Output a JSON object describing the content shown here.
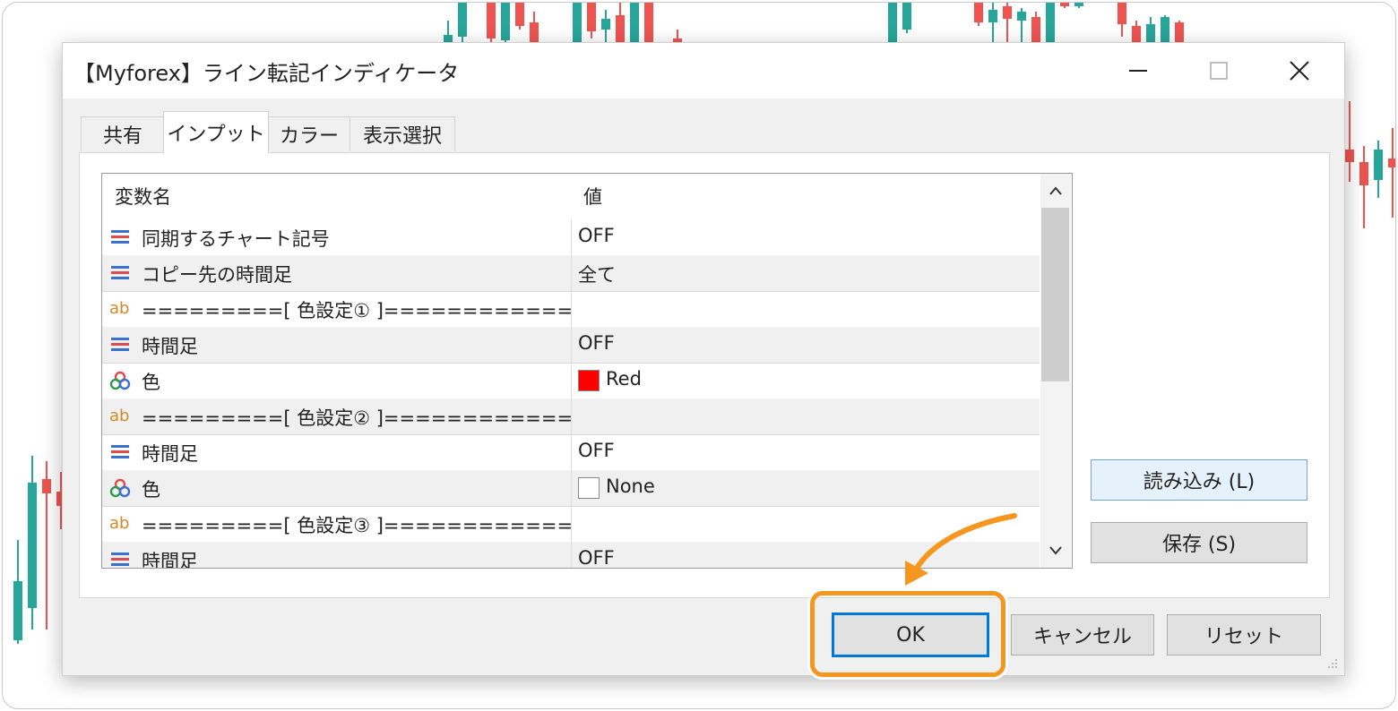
{
  "dialog": {
    "title": "【Myforex】ライン転記インディケータ",
    "controls": {
      "minimize": "minimize-icon",
      "maximize": "maximize-icon",
      "close": "close-icon"
    }
  },
  "tabs": [
    {
      "label": "共有",
      "active": false
    },
    {
      "label": "インプット",
      "active": true
    },
    {
      "label": "カラー",
      "active": false
    },
    {
      "label": "表示選択",
      "active": false
    }
  ],
  "grid": {
    "headers": {
      "name": "変数名",
      "value": "値"
    },
    "rows": [
      {
        "icon": "list-icon",
        "name": "同期するチャート記号",
        "value": "OFF"
      },
      {
        "icon": "list-icon",
        "name": "コピー先の時間足",
        "value": "全て"
      },
      {
        "icon": "ab-icon",
        "icon_text": "ab",
        "name": "=========[ 色設定① ]============",
        "value": ""
      },
      {
        "icon": "list-icon",
        "name": "時間足",
        "value": "OFF"
      },
      {
        "icon": "color-icon",
        "name": "色",
        "value": "Red",
        "swatch": "#ff0000"
      },
      {
        "icon": "ab-icon",
        "icon_text": "ab",
        "name": "=========[ 色設定② ]============",
        "value": ""
      },
      {
        "icon": "list-icon",
        "name": "時間足",
        "value": "OFF"
      },
      {
        "icon": "color-icon",
        "name": "色",
        "value": "None",
        "swatch": "#ffffff"
      },
      {
        "icon": "ab-icon",
        "icon_text": "ab",
        "name": "=========[ 色設定③ ]============",
        "value": ""
      },
      {
        "icon": "list-icon",
        "name": "時間足",
        "value": "OFF"
      }
    ]
  },
  "buttons": {
    "load": "読み込み (L)",
    "save": "保存 (S)",
    "ok": "OK",
    "cancel": "キャンセル",
    "reset": "リセット"
  },
  "colors": {
    "highlight": "#f5961e",
    "bull": "#26a69a",
    "bear": "#ef5350",
    "focus_border": "#0078d7"
  }
}
